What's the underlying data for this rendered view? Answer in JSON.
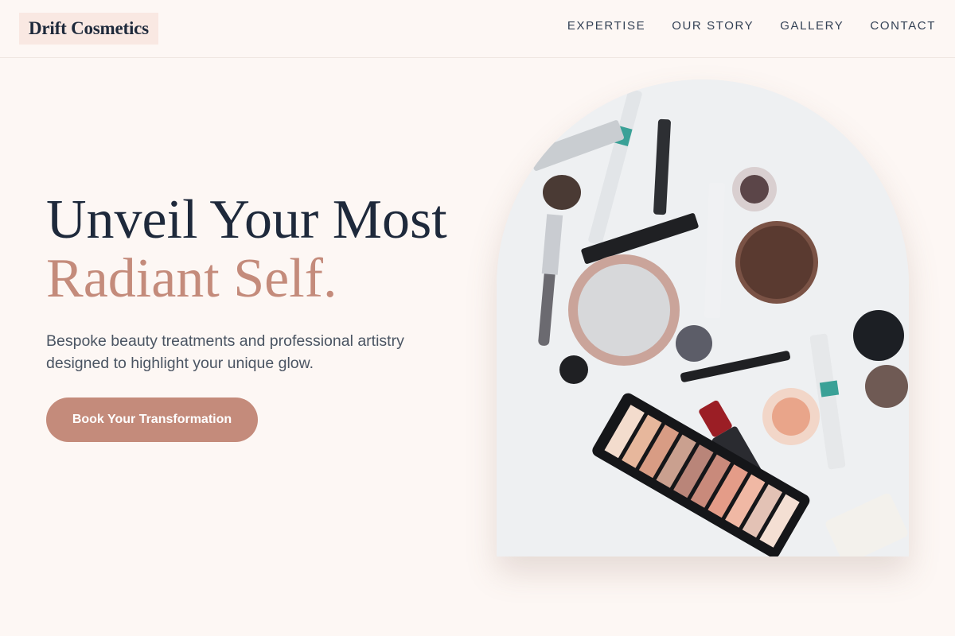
{
  "brand": {
    "name": "Drift Cosmetics"
  },
  "nav": {
    "items": [
      "EXPERTISE",
      "OUR STORY",
      "GALLERY",
      "CONTACT"
    ]
  },
  "hero": {
    "title_line1": "Unveil Your Most",
    "title_line2": "Radiant Self.",
    "subtitle": "Bespoke beauty treatments and professional artistry designed to highlight your unique glow.",
    "cta_label": "Book Your Transformation"
  },
  "image": {
    "subject": "makeup-flatlay-photo"
  },
  "colors": {
    "background": "#fdf7f4",
    "accent": "#c48b7b",
    "heading": "#1e293b",
    "logo_bg": "#f9e8e2"
  }
}
